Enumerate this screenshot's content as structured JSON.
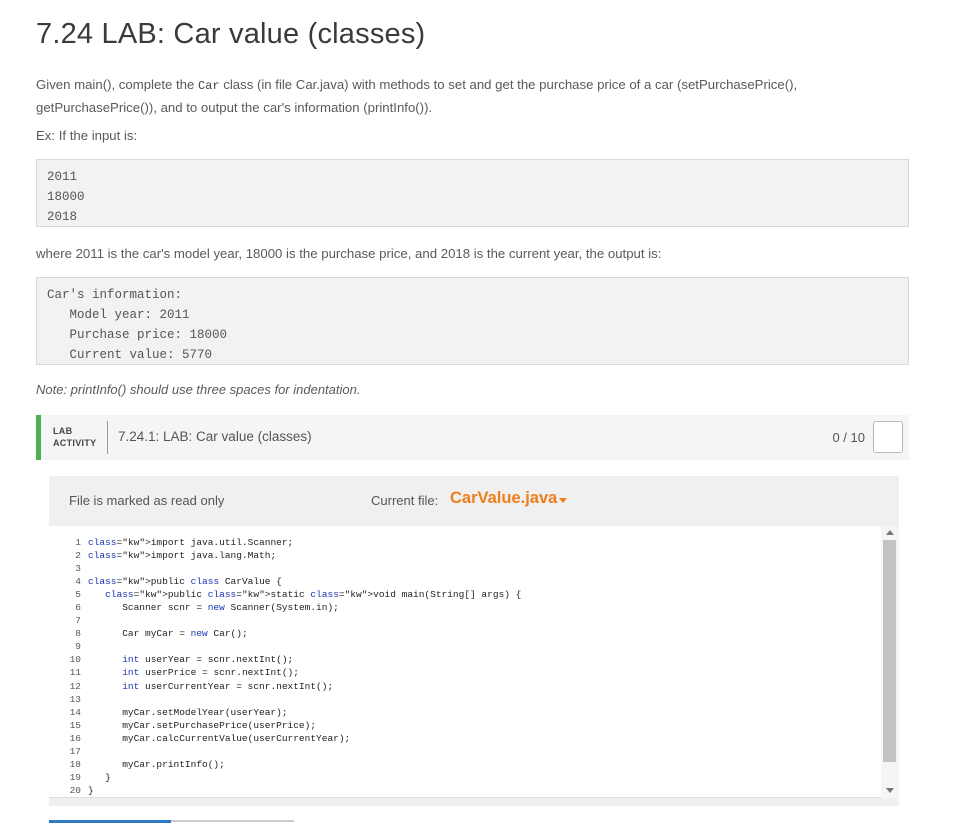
{
  "page": {
    "title": "7.24 LAB: Car value (classes)"
  },
  "intro": {
    "part1": "Given main(), complete the ",
    "code1": "Car",
    "part2": " class (in file Car.java) with methods to set and get the purchase price of a car (setPurchasePrice(),",
    "line2": "getPurchasePrice()), and to output the car's information (printInfo())."
  },
  "example_label": "Ex: If the input is:",
  "input_block": "2011\n18000\n2018",
  "explanation": "where 2011 is the car's model year, 18000 is the purchase price, and 2018 is the current year, the output is:",
  "output_block": "Car's information:\n   Model year: 2011\n   Purchase price: 18000\n   Current value: 5770",
  "note": "Note: printInfo() should use three spaces for indentation.",
  "lab": {
    "tag_line1": "LAB",
    "tag_line2": "ACTIVITY",
    "title": "7.24.1: LAB: Car value (classes)",
    "score": "0 / 10"
  },
  "editor": {
    "readonly_label": "File is marked as read only",
    "current_file_label": "Current file:",
    "current_file": "CarValue.java",
    "line_numbers": [
      "1",
      "2",
      "3",
      "4",
      "5",
      "6",
      "7",
      "8",
      "9",
      "10",
      "11",
      "12",
      "13",
      "14",
      "15",
      "16",
      "17",
      "18",
      "19",
      "20"
    ],
    "code_lines": [
      "import java.util.Scanner;",
      "import java.lang.Math;",
      "",
      "public class CarValue {",
      "   public static void main(String[] args) {",
      "      Scanner scnr = new Scanner(System.in);",
      "",
      "      Car myCar = new Car();",
      "",
      "      int userYear = scnr.nextInt();",
      "      int userPrice = scnr.nextInt();",
      "      int userCurrentYear = scnr.nextInt();",
      "",
      "      myCar.setModelYear(userYear);",
      "      myCar.setPurchasePrice(userPrice);",
      "      myCar.calcCurrentValue(userCurrentYear);",
      "",
      "      myCar.printInfo();",
      "   }",
      "}"
    ]
  },
  "icons": {
    "file_dropdown": "caret-down-icon",
    "score_checkbox": "checkbox-icon",
    "scroll_up": "scroll-up-icon",
    "scroll_down": "scroll-down-icon"
  },
  "colors": {
    "accent_orange": "#f07d1a",
    "lab_green": "#4caf50",
    "keyword_blue": "#1a35b0"
  }
}
